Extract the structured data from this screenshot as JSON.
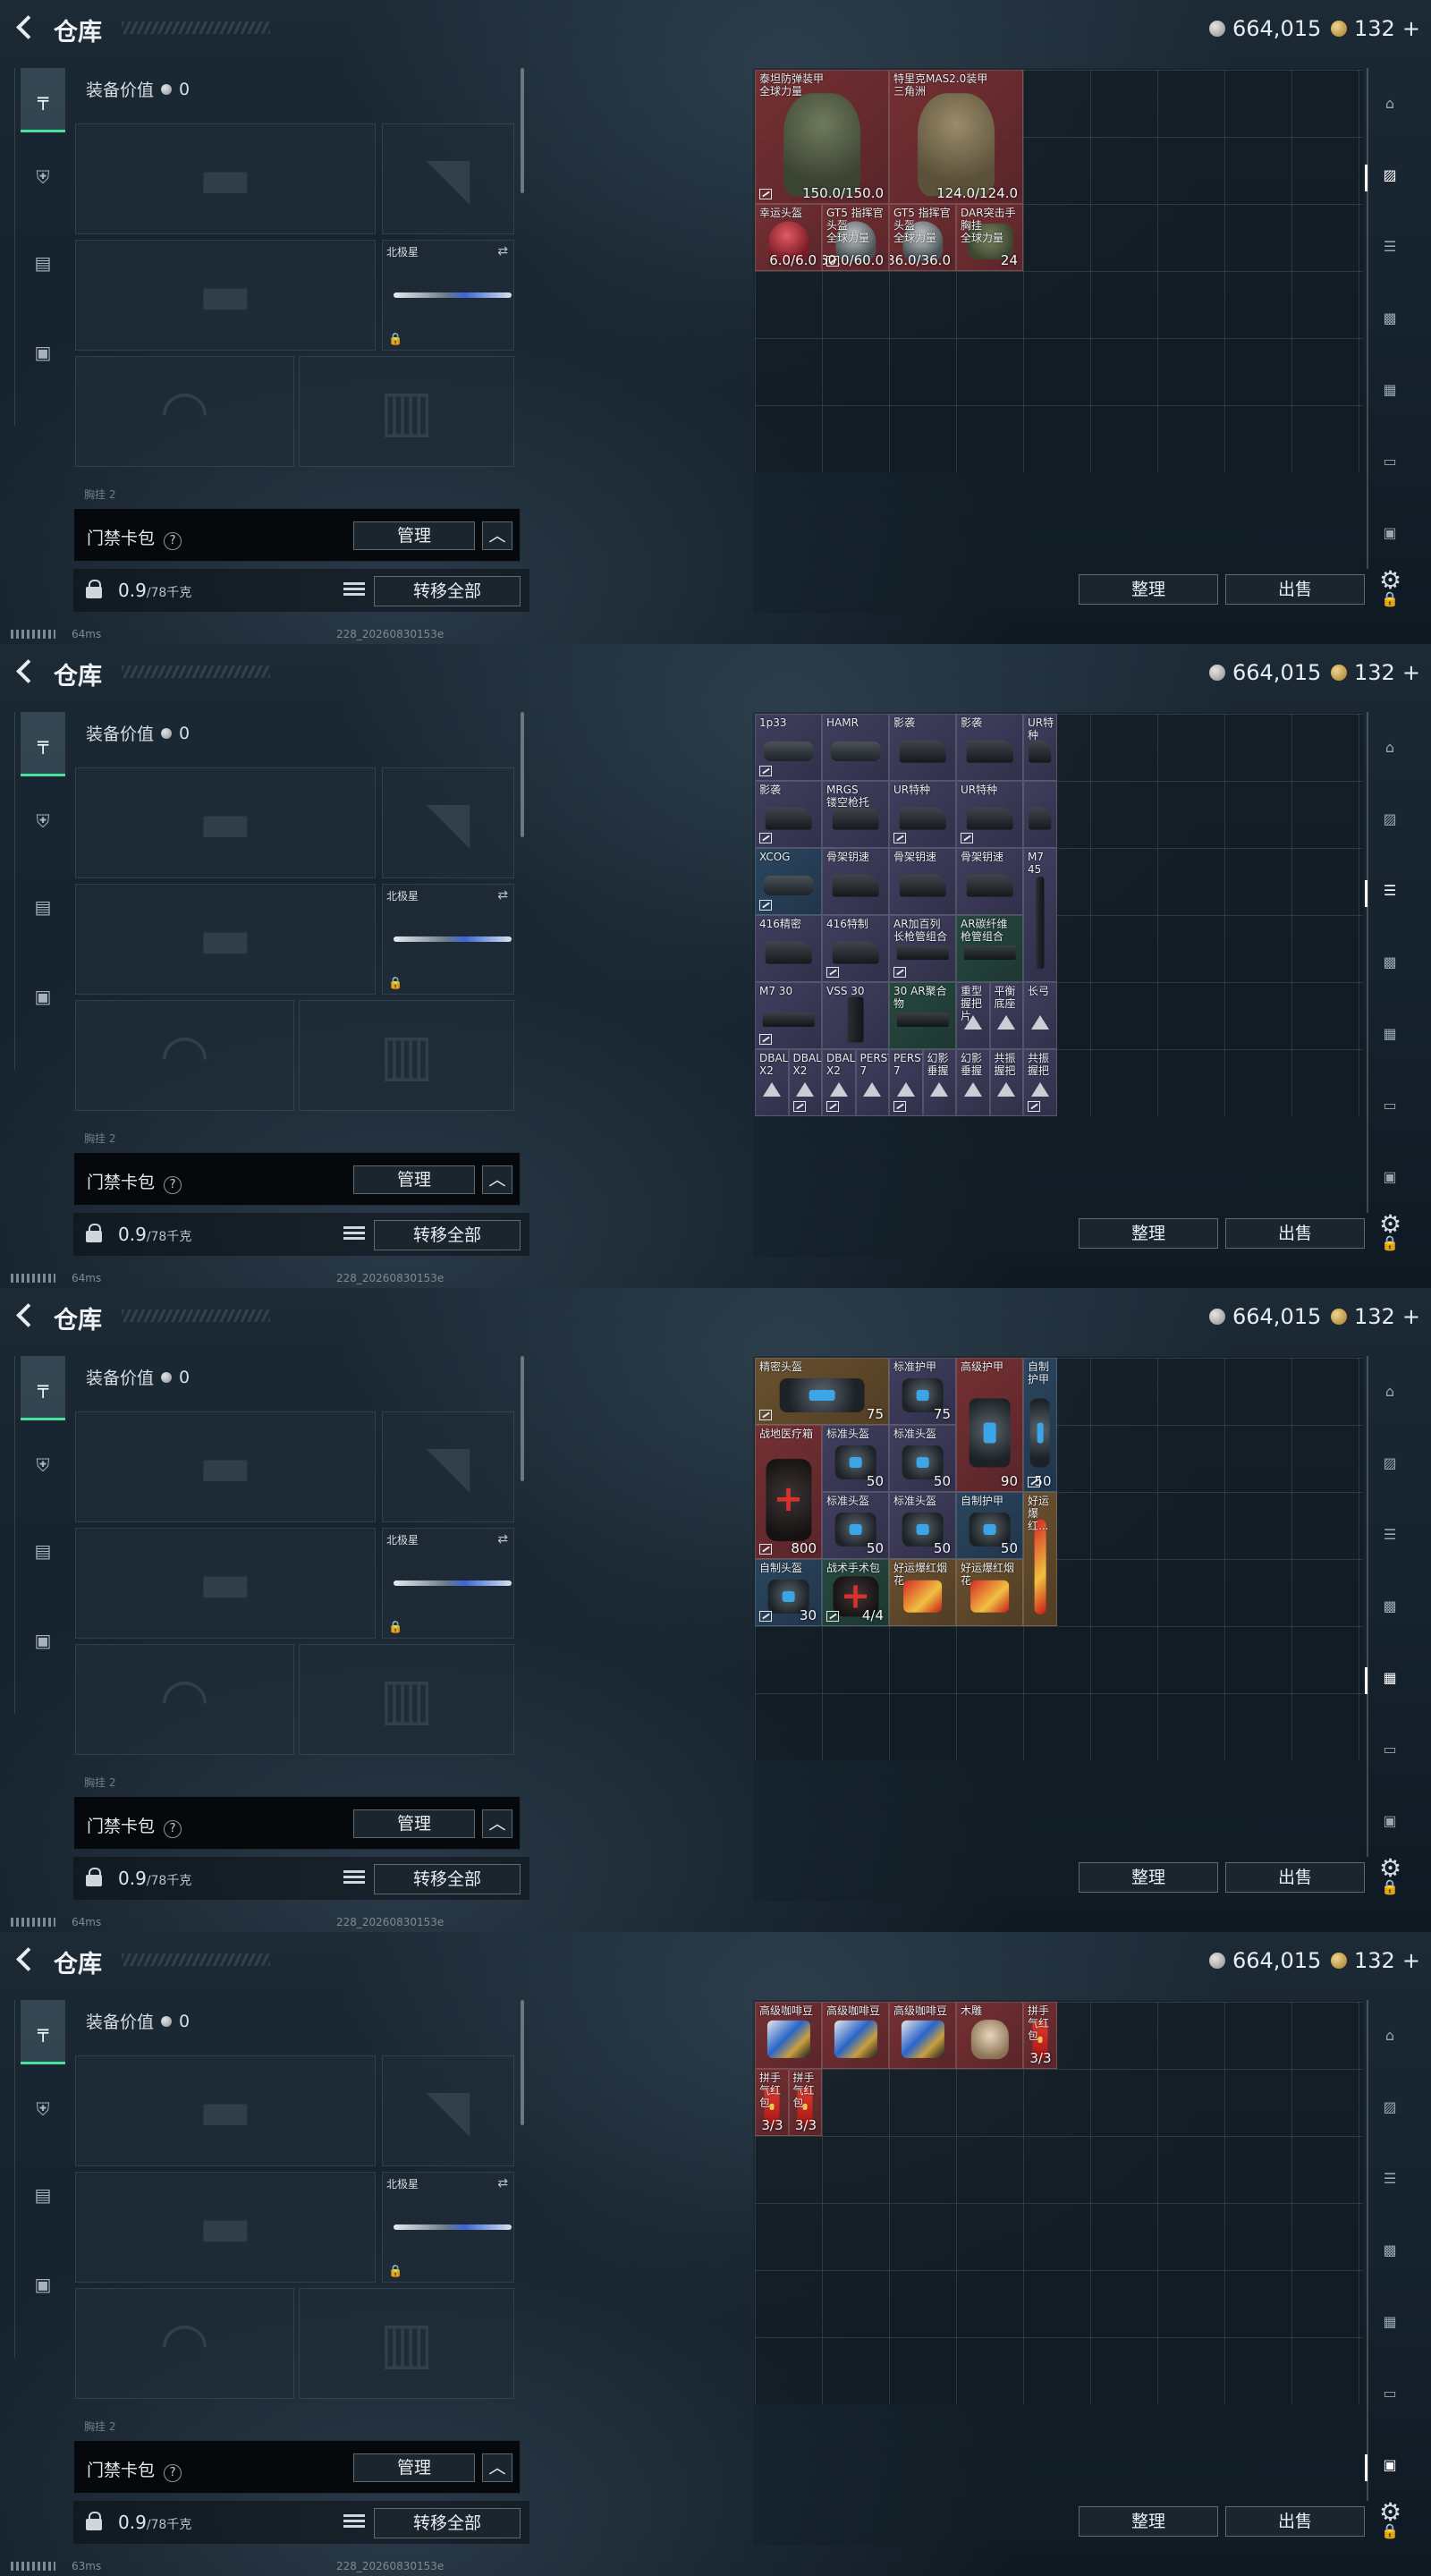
{
  "screens": [
    {
      "title": "仓库",
      "currency": {
        "silver": "664,015",
        "gold": "132",
        "plus": "+"
      },
      "equip_value_label": "装备价值",
      "equip_value": "0",
      "melee_name": "北极星",
      "partial_label": "胸挂 2",
      "keycard_label": "门禁卡包",
      "manage_label": "管理",
      "weight": "0.9",
      "weight_max": "/78千克",
      "transfer_label": "转移全部",
      "sort_label": "整理",
      "sell_label": "出售",
      "ping": "64ms",
      "build": "228_20260830153e",
      "active_tab": 1,
      "items": [
        {
          "name": "泰坦防弹装甲\n全球力量",
          "value": "150.0/150.0",
          "rarity": "red",
          "art": "vest",
          "c": 0,
          "r": 0,
          "w": 2,
          "h": 2,
          "tag": true
        },
        {
          "name": "特里克MAS2.0装甲\n三角洲",
          "value": "124.0/124.0",
          "rarity": "red",
          "art": "vest-t",
          "c": 2,
          "r": 0,
          "w": 2,
          "h": 2,
          "tag": false
        },
        {
          "name": "幸运头盔",
          "value": "6.0/6.0",
          "rarity": "red",
          "art": "helm-red",
          "c": 0,
          "r": 2,
          "w": 1,
          "h": 1,
          "tag": false
        },
        {
          "name": "GT5 指挥官头盔\n全球力量",
          "value": "60.0/60.0",
          "rarity": "red",
          "art": "helm",
          "c": 1,
          "r": 2,
          "w": 1,
          "h": 1,
          "tag": true
        },
        {
          "name": "GT5 指挥官头盔\n全球力量",
          "value": "36.0/36.0",
          "rarity": "red",
          "art": "helm",
          "c": 2,
          "r": 2,
          "w": 1,
          "h": 1,
          "tag": false
        },
        {
          "name": "DAR突击手胸挂\n全球力量",
          "value": "24",
          "rarity": "red",
          "art": "bag",
          "c": 3,
          "r": 2,
          "w": 1,
          "h": 1,
          "tag": false
        }
      ]
    },
    {
      "title": "仓库",
      "currency": {
        "silver": "664,015",
        "gold": "132",
        "plus": "+"
      },
      "equip_value_label": "装备价值",
      "equip_value": "0",
      "melee_name": "北极星",
      "partial_label": "胸挂 2",
      "keycard_label": "门禁卡包",
      "manage_label": "管理",
      "weight": "0.9",
      "weight_max": "/78千克",
      "transfer_label": "转移全部",
      "sort_label": "整理",
      "sell_label": "出售",
      "ping": "64ms",
      "build": "228_20260830153e",
      "active_tab": 2,
      "items": [
        {
          "name": "1p33",
          "value": "",
          "rarity": "purple",
          "art": "scope",
          "c": 0,
          "r": 0,
          "w": 1,
          "h": 1,
          "tag": true
        },
        {
          "name": "HAMR",
          "value": "",
          "rarity": "purple",
          "art": "scope",
          "c": 1,
          "r": 0,
          "w": 1,
          "h": 1,
          "tag": false
        },
        {
          "name": "影袭",
          "value": "",
          "rarity": "purple",
          "art": "stock",
          "c": 2,
          "r": 0,
          "w": 1,
          "h": 1,
          "tag": false
        },
        {
          "name": "影袭",
          "value": "",
          "rarity": "purple",
          "art": "stock",
          "c": 3,
          "r": 0,
          "w": 1,
          "h": 1,
          "tag": false
        },
        {
          "name": "UR特种",
          "value": "",
          "rarity": "purple",
          "art": "stock",
          "c": 4,
          "r": 0,
          "w": 0.5,
          "h": 1,
          "tag": false
        },
        {
          "name": "影袭",
          "value": "",
          "rarity": "purple",
          "art": "stock",
          "c": 0,
          "r": 1,
          "w": 1,
          "h": 1,
          "tag": true
        },
        {
          "name": "MRGS\n镂空枪托",
          "value": "",
          "rarity": "purple",
          "art": "stock",
          "c": 1,
          "r": 1,
          "w": 1,
          "h": 1,
          "tag": false
        },
        {
          "name": "UR特种",
          "value": "",
          "rarity": "purple",
          "art": "stock",
          "c": 2,
          "r": 1,
          "w": 1,
          "h": 1,
          "tag": true
        },
        {
          "name": "UR特种",
          "value": "",
          "rarity": "purple",
          "art": "stock",
          "c": 3,
          "r": 1,
          "w": 1,
          "h": 1,
          "tag": true
        },
        {
          "name": "",
          "value": "",
          "rarity": "purple",
          "art": "stock",
          "c": 4,
          "r": 1,
          "w": 0.5,
          "h": 1,
          "tag": false
        },
        {
          "name": "XCOG",
          "value": "",
          "rarity": "blue",
          "art": "scope",
          "c": 0,
          "r": 2,
          "w": 1,
          "h": 1,
          "tag": true
        },
        {
          "name": "骨架钥速",
          "value": "",
          "rarity": "purple",
          "art": "stock",
          "c": 1,
          "r": 2,
          "w": 1,
          "h": 1,
          "tag": false
        },
        {
          "name": "骨架钥速",
          "value": "",
          "rarity": "purple",
          "art": "stock",
          "c": 2,
          "r": 2,
          "w": 1,
          "h": 1,
          "tag": false
        },
        {
          "name": "骨架钥速",
          "value": "",
          "rarity": "purple",
          "art": "stock",
          "c": 3,
          "r": 2,
          "w": 1,
          "h": 1,
          "tag": false
        },
        {
          "name": "M7 45",
          "value": "",
          "rarity": "purple",
          "art": "mag",
          "c": 4,
          "r": 2,
          "w": 0.5,
          "h": 2,
          "tag": false
        },
        {
          "name": "416精密",
          "value": "",
          "rarity": "purple",
          "art": "stock",
          "c": 0,
          "r": 3,
          "w": 1,
          "h": 1,
          "tag": false
        },
        {
          "name": "416特制",
          "value": "",
          "rarity": "purple",
          "art": "stock",
          "c": 1,
          "r": 3,
          "w": 1,
          "h": 1,
          "tag": true
        },
        {
          "name": "AR加百列\n长枪管组合",
          "value": "",
          "rarity": "purple",
          "art": "rail",
          "c": 2,
          "r": 3,
          "w": 1,
          "h": 1,
          "tag": true
        },
        {
          "name": "AR碳纤维\n枪管组合",
          "value": "",
          "rarity": "green",
          "art": "rail",
          "c": 3,
          "r": 3,
          "w": 1,
          "h": 1,
          "tag": false
        },
        {
          "name": "M7 30",
          "value": "",
          "rarity": "purple",
          "art": "rail",
          "c": 0,
          "r": 4,
          "w": 1,
          "h": 1,
          "tag": true
        },
        {
          "name": "VSS 30",
          "value": "",
          "rarity": "purple",
          "art": "mag",
          "c": 1,
          "r": 4,
          "w": 1,
          "h": 1,
          "tag": false
        },
        {
          "name": "30 AR聚合物",
          "value": "",
          "rarity": "green",
          "art": "rail",
          "c": 2,
          "r": 4,
          "w": 1,
          "h": 1,
          "tag": false
        },
        {
          "name": "重型握把片",
          "value": "",
          "rarity": "purple",
          "art": "tri",
          "c": 3,
          "r": 4,
          "w": 0.5,
          "h": 1,
          "tag": false
        },
        {
          "name": "平衡底座",
          "value": "",
          "rarity": "purple",
          "art": "tri",
          "c": 3.5,
          "r": 4,
          "w": 0.5,
          "h": 1,
          "tag": false
        },
        {
          "name": "长弓",
          "value": "",
          "rarity": "purple",
          "art": "tri",
          "c": 4,
          "r": 4,
          "w": 0.5,
          "h": 1,
          "tag": false
        },
        {
          "name": "DBAL-X2",
          "value": "",
          "rarity": "purple",
          "art": "tri",
          "c": 0,
          "r": 5,
          "w": 0.5,
          "h": 1,
          "tag": false
        },
        {
          "name": "DBAL-X2",
          "value": "",
          "rarity": "purple",
          "art": "tri",
          "c": 0.5,
          "r": 5,
          "w": 0.5,
          "h": 1,
          "tag": true
        },
        {
          "name": "DBAL-X2",
          "value": "",
          "rarity": "purple",
          "art": "tri",
          "c": 1,
          "r": 5,
          "w": 0.5,
          "h": 1,
          "tag": true
        },
        {
          "name": "PERST-7",
          "value": "",
          "rarity": "purple",
          "art": "tri",
          "c": 1.5,
          "r": 5,
          "w": 0.5,
          "h": 1,
          "tag": false
        },
        {
          "name": "PERST-7",
          "value": "",
          "rarity": "purple",
          "art": "tri",
          "c": 2,
          "r": 5,
          "w": 0.5,
          "h": 1,
          "tag": true
        },
        {
          "name": "幻影垂握",
          "value": "",
          "rarity": "purple",
          "art": "tri",
          "c": 2.5,
          "r": 5,
          "w": 0.5,
          "h": 1,
          "tag": false
        },
        {
          "name": "幻影垂握",
          "value": "",
          "rarity": "purple",
          "art": "tri",
          "c": 3,
          "r": 5,
          "w": 0.5,
          "h": 1,
          "tag": false
        },
        {
          "name": "共振握把",
          "value": "",
          "rarity": "purple",
          "art": "tri",
          "c": 3.5,
          "r": 5,
          "w": 0.5,
          "h": 1,
          "tag": false
        },
        {
          "name": "共振握把",
          "value": "",
          "rarity": "purple",
          "art": "tri",
          "c": 4,
          "r": 5,
          "w": 0.5,
          "h": 1,
          "tag": true
        }
      ]
    },
    {
      "title": "仓库",
      "currency": {
        "silver": "664,015",
        "gold": "132",
        "plus": "+"
      },
      "equip_value_label": "装备价值",
      "equip_value": "0",
      "melee_name": "北极星",
      "partial_label": "胸挂 2",
      "keycard_label": "门禁卡包",
      "manage_label": "管理",
      "weight": "0.9",
      "weight_max": "/78千克",
      "transfer_label": "转移全部",
      "sort_label": "整理",
      "sell_label": "出售",
      "ping": "64ms",
      "build": "228_20260830153e",
      "active_tab": 4,
      "items": [
        {
          "name": "精密头盔",
          "value": "75",
          "rarity": "gold",
          "art": "case",
          "c": 0,
          "r": 0,
          "w": 2,
          "h": 1,
          "tag": true
        },
        {
          "name": "标准护甲",
          "value": "75",
          "rarity": "purple",
          "art": "case",
          "c": 2,
          "r": 0,
          "w": 1,
          "h": 1,
          "tag": false
        },
        {
          "name": "高级护甲",
          "value": "90",
          "rarity": "red",
          "art": "case",
          "c": 3,
          "r": 0,
          "w": 1,
          "h": 2,
          "tag": false
        },
        {
          "name": "自制护甲",
          "value": "50",
          "rarity": "blue",
          "art": "case",
          "c": 4,
          "r": 0,
          "w": 0.5,
          "h": 2,
          "tag": true
        },
        {
          "name": "战地医疗箱",
          "value": "800",
          "rarity": "red",
          "art": "med",
          "c": 0,
          "r": 1,
          "w": 1,
          "h": 2,
          "tag": true
        },
        {
          "name": "标准头盔",
          "value": "50",
          "rarity": "purple",
          "art": "case",
          "c": 1,
          "r": 1,
          "w": 1,
          "h": 1,
          "tag": false
        },
        {
          "name": "标准头盔",
          "value": "50",
          "rarity": "purple",
          "art": "case",
          "c": 2,
          "r": 1,
          "w": 1,
          "h": 1,
          "tag": false
        },
        {
          "name": "标准头盔",
          "value": "50",
          "rarity": "purple",
          "art": "case",
          "c": 1,
          "r": 2,
          "w": 1,
          "h": 1,
          "tag": false
        },
        {
          "name": "标准头盔",
          "value": "50",
          "rarity": "purple",
          "art": "case",
          "c": 2,
          "r": 2,
          "w": 1,
          "h": 1,
          "tag": false
        },
        {
          "name": "自制护甲",
          "value": "50",
          "rarity": "blue",
          "art": "case",
          "c": 3,
          "r": 2,
          "w": 1,
          "h": 1,
          "tag": false
        },
        {
          "name": "好运爆红...",
          "value": "",
          "rarity": "gold",
          "art": "fire-v",
          "c": 4,
          "r": 2,
          "w": 0.5,
          "h": 2,
          "tag": false
        },
        {
          "name": "自制头盔",
          "value": "30",
          "rarity": "blue",
          "art": "case",
          "c": 0,
          "r": 3,
          "w": 1,
          "h": 1,
          "tag": true
        },
        {
          "name": "战术手术包",
          "value": "4/4",
          "rarity": "green",
          "art": "med",
          "c": 1,
          "r": 3,
          "w": 1,
          "h": 1,
          "tag": true
        },
        {
          "name": "好运爆红烟花",
          "value": "",
          "rarity": "gold",
          "art": "fire",
          "c": 2,
          "r": 3,
          "w": 1,
          "h": 1,
          "tag": false
        },
        {
          "name": "好运爆红烟花",
          "value": "",
          "rarity": "gold",
          "art": "fire",
          "c": 3,
          "r": 3,
          "w": 1,
          "h": 1,
          "tag": false
        }
      ]
    },
    {
      "title": "仓库",
      "currency": {
        "silver": "664,015",
        "gold": "132",
        "plus": "+"
      },
      "equip_value_label": "装备价值",
      "equip_value": "0",
      "melee_name": "北极星",
      "partial_label": "胸挂 2",
      "keycard_label": "门禁卡包",
      "manage_label": "管理",
      "weight": "0.9",
      "weight_max": "/78千克",
      "transfer_label": "转移全部",
      "sort_label": "整理",
      "sell_label": "出售",
      "ping": "63ms",
      "build": "228_20260830153e",
      "active_tab": 6,
      "items": [
        {
          "name": "高级咖啡豆",
          "value": "",
          "rarity": "red",
          "art": "coffee",
          "c": 0,
          "r": 0,
          "w": 1,
          "h": 1,
          "tag": false
        },
        {
          "name": "高级咖啡豆",
          "value": "",
          "rarity": "red",
          "art": "coffee",
          "c": 1,
          "r": 0,
          "w": 1,
          "h": 1,
          "tag": false
        },
        {
          "name": "高级咖啡豆",
          "value": "",
          "rarity": "red",
          "art": "coffee",
          "c": 2,
          "r": 0,
          "w": 1,
          "h": 1,
          "tag": false
        },
        {
          "name": "木雕",
          "value": "",
          "rarity": "red",
          "art": "carve",
          "c": 3,
          "r": 0,
          "w": 1,
          "h": 1,
          "tag": false
        },
        {
          "name": "拼手气红包",
          "value": "3/3",
          "rarity": "red",
          "art": "env",
          "c": 4,
          "r": 0,
          "w": 0.5,
          "h": 1,
          "tag": false
        },
        {
          "name": "拼手气红包",
          "value": "3/3",
          "rarity": "red",
          "art": "env",
          "c": 0,
          "r": 1,
          "w": 0.5,
          "h": 1,
          "tag": false
        },
        {
          "name": "拼手气红包",
          "value": "3/3",
          "rarity": "red",
          "art": "env",
          "c": 0.5,
          "r": 1,
          "w": 0.5,
          "h": 1,
          "tag": false
        }
      ]
    }
  ]
}
